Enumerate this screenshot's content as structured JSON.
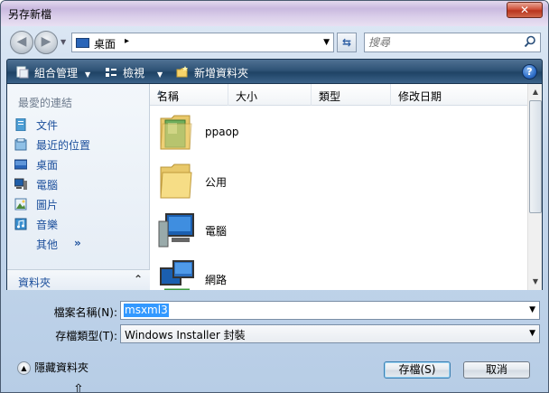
{
  "window": {
    "title": "另存新檔",
    "close_label": "✕"
  },
  "address_bar": {
    "location": "桌面",
    "separator": "▸",
    "search_placeholder": "搜尋"
  },
  "toolbar": {
    "organize_label": "組合管理",
    "views_label": "檢視",
    "new_folder_label": "新增資料夾",
    "help_label": "?"
  },
  "favorites": {
    "header": "最愛的連結",
    "items": [
      {
        "label": "文件",
        "icon": "documents-icon"
      },
      {
        "label": "最近的位置",
        "icon": "recent-places-icon"
      },
      {
        "label": "桌面",
        "icon": "desktop-icon"
      },
      {
        "label": "電腦",
        "icon": "computer-icon"
      },
      {
        "label": "圖片",
        "icon": "pictures-icon"
      },
      {
        "label": "音樂",
        "icon": "music-icon"
      }
    ],
    "more_label": "其他",
    "more_chevron": "»",
    "folders_label": "資料夾",
    "folders_chevron": "⌃"
  },
  "file_list": {
    "columns": [
      "名稱",
      "大小",
      "類型",
      "修改日期"
    ],
    "files": [
      {
        "name": "ppaop",
        "icon": "user-folder-icon"
      },
      {
        "name": "公用",
        "icon": "folder-icon"
      },
      {
        "name": "電腦",
        "icon": "computer-icon"
      },
      {
        "name": "網路",
        "icon": "network-icon"
      }
    ]
  },
  "save_form": {
    "filename_label": "檔案名稱(N):",
    "filename_value": "msxml3",
    "filetype_label": "存檔類型(T):",
    "filetype_value": "Windows Installer 封裝",
    "hide_folders_label": "隱藏資料夾",
    "save_button": "存檔(S)",
    "cancel_button": "取消"
  }
}
